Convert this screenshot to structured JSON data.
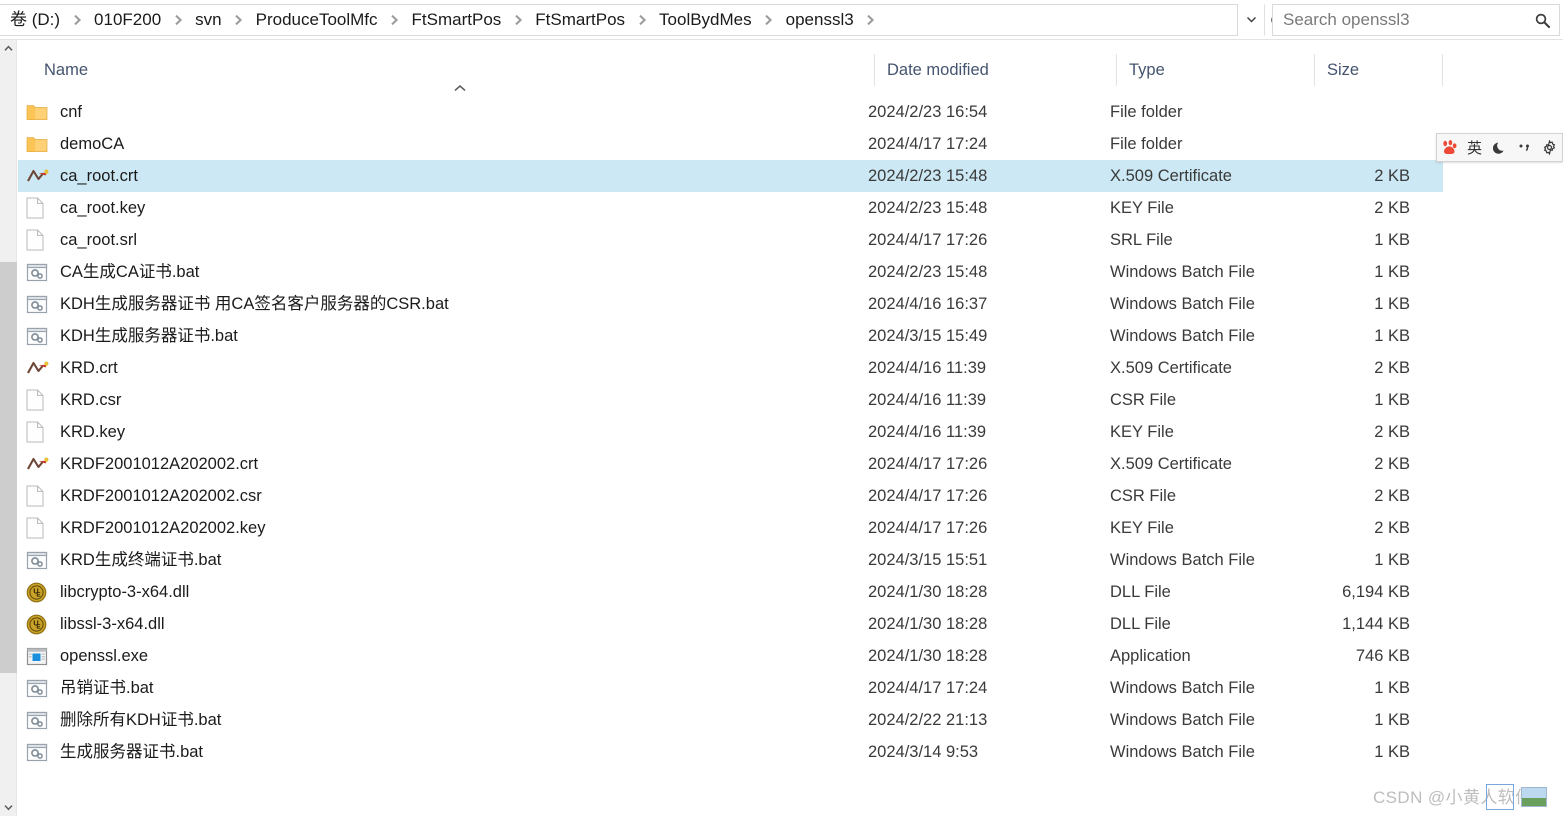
{
  "address": {
    "crumbs": [
      "卷 (D:)",
      "010F200",
      "svn",
      "ProduceToolMfc",
      "FtSmartPos",
      "FtSmartPos",
      "ToolBydMes",
      "openssl3"
    ],
    "dropdown_icon": "chevron-down-icon",
    "refresh_icon": "refresh-icon"
  },
  "search": {
    "placeholder": "Search openssl3",
    "value": "",
    "icon": "search-icon"
  },
  "columns": {
    "name": "Name",
    "date_modified": "Date modified",
    "type": "Type",
    "size": "Size",
    "sort_indicator": "chevron-up-icon"
  },
  "files": [
    {
      "name": "cnf",
      "date": "2024/2/23 16:54",
      "type": "File folder",
      "size": "",
      "icon": "folder-icon",
      "selected": false
    },
    {
      "name": "demoCA",
      "date": "2024/4/17 17:24",
      "type": "File folder",
      "size": "",
      "icon": "folder-icon",
      "selected": false
    },
    {
      "name": "ca_root.crt",
      "date": "2024/2/23 15:48",
      "type": "X.509 Certificate",
      "size": "2 KB",
      "icon": "certificate-icon",
      "selected": true
    },
    {
      "name": "ca_root.key",
      "date": "2024/2/23 15:48",
      "type": "KEY File",
      "size": "2 KB",
      "icon": "blank-file-icon",
      "selected": false
    },
    {
      "name": "ca_root.srl",
      "date": "2024/4/17 17:26",
      "type": "SRL File",
      "size": "1 KB",
      "icon": "blank-file-icon",
      "selected": false
    },
    {
      "name": "CA生成CA证书.bat",
      "date": "2024/2/23 15:48",
      "type": "Windows Batch File",
      "size": "1 KB",
      "icon": "batch-file-icon",
      "selected": false
    },
    {
      "name": "KDH生成服务器证书 用CA签名客户服务器的CSR.bat",
      "date": "2024/4/16 16:37",
      "type": "Windows Batch File",
      "size": "1 KB",
      "icon": "batch-file-icon",
      "selected": false
    },
    {
      "name": "KDH生成服务器证书.bat",
      "date": "2024/3/15 15:49",
      "type": "Windows Batch File",
      "size": "1 KB",
      "icon": "batch-file-icon",
      "selected": false
    },
    {
      "name": "KRD.crt",
      "date": "2024/4/16 11:39",
      "type": "X.509 Certificate",
      "size": "2 KB",
      "icon": "certificate-icon",
      "selected": false
    },
    {
      "name": "KRD.csr",
      "date": "2024/4/16 11:39",
      "type": "CSR File",
      "size": "1 KB",
      "icon": "blank-file-icon",
      "selected": false
    },
    {
      "name": "KRD.key",
      "date": "2024/4/16 11:39",
      "type": "KEY File",
      "size": "2 KB",
      "icon": "blank-file-icon",
      "selected": false
    },
    {
      "name": "KRDF2001012A202002.crt",
      "date": "2024/4/17 17:26",
      "type": "X.509 Certificate",
      "size": "2 KB",
      "icon": "certificate-icon",
      "selected": false
    },
    {
      "name": "KRDF2001012A202002.csr",
      "date": "2024/4/17 17:26",
      "type": "CSR File",
      "size": "2 KB",
      "icon": "blank-file-icon",
      "selected": false
    },
    {
      "name": "KRDF2001012A202002.key",
      "date": "2024/4/17 17:26",
      "type": "KEY File",
      "size": "2 KB",
      "icon": "blank-file-icon",
      "selected": false
    },
    {
      "name": "KRD生成终端证书.bat",
      "date": "2024/3/15 15:51",
      "type": "Windows Batch File",
      "size": "1 KB",
      "icon": "batch-file-icon",
      "selected": false
    },
    {
      "name": "libcrypto-3-x64.dll",
      "date": "2024/1/30 18:28",
      "type": "DLL File",
      "size": "6,194 KB",
      "icon": "dll-icon",
      "selected": false
    },
    {
      "name": "libssl-3-x64.dll",
      "date": "2024/1/30 18:28",
      "type": "DLL File",
      "size": "1,144 KB",
      "icon": "dll-icon",
      "selected": false
    },
    {
      "name": "openssl.exe",
      "date": "2024/1/30 18:28",
      "type": "Application",
      "size": "746 KB",
      "icon": "application-icon",
      "selected": false
    },
    {
      "name": "吊销证书.bat",
      "date": "2024/4/17 17:24",
      "type": "Windows Batch File",
      "size": "1 KB",
      "icon": "batch-file-icon",
      "selected": false
    },
    {
      "name": "删除所有KDH证书.bat",
      "date": "2024/2/22 21:13",
      "type": "Windows Batch File",
      "size": "1 KB",
      "icon": "batch-file-icon",
      "selected": false
    },
    {
      "name": "生成服务器证书.bat",
      "date": "2024/3/14 9:53",
      "type": "Windows Batch File",
      "size": "1 KB",
      "icon": "batch-file-icon",
      "selected": false
    }
  ],
  "ime_bar": {
    "items": [
      {
        "name": "baidu-paw-logo-icon",
        "glyph": ""
      },
      {
        "name": "english-mode-icon",
        "glyph": "英"
      },
      {
        "name": "moon-icon",
        "glyph": ""
      },
      {
        "name": "punctuation-icon",
        "glyph": ""
      },
      {
        "name": "gear-icon",
        "glyph": ""
      }
    ]
  },
  "watermark": {
    "text": "CSDN @小黄人软件"
  },
  "colors": {
    "selection": "#cce8f4",
    "header_text": "#44546f",
    "folder": "#ffd176",
    "accent_red": "#e8453c",
    "scrollbar_thumb": "#cdcdcd"
  },
  "scrollbar": {
    "up_icon": "chevron-up-icon",
    "down_icon": "chevron-down-icon"
  }
}
